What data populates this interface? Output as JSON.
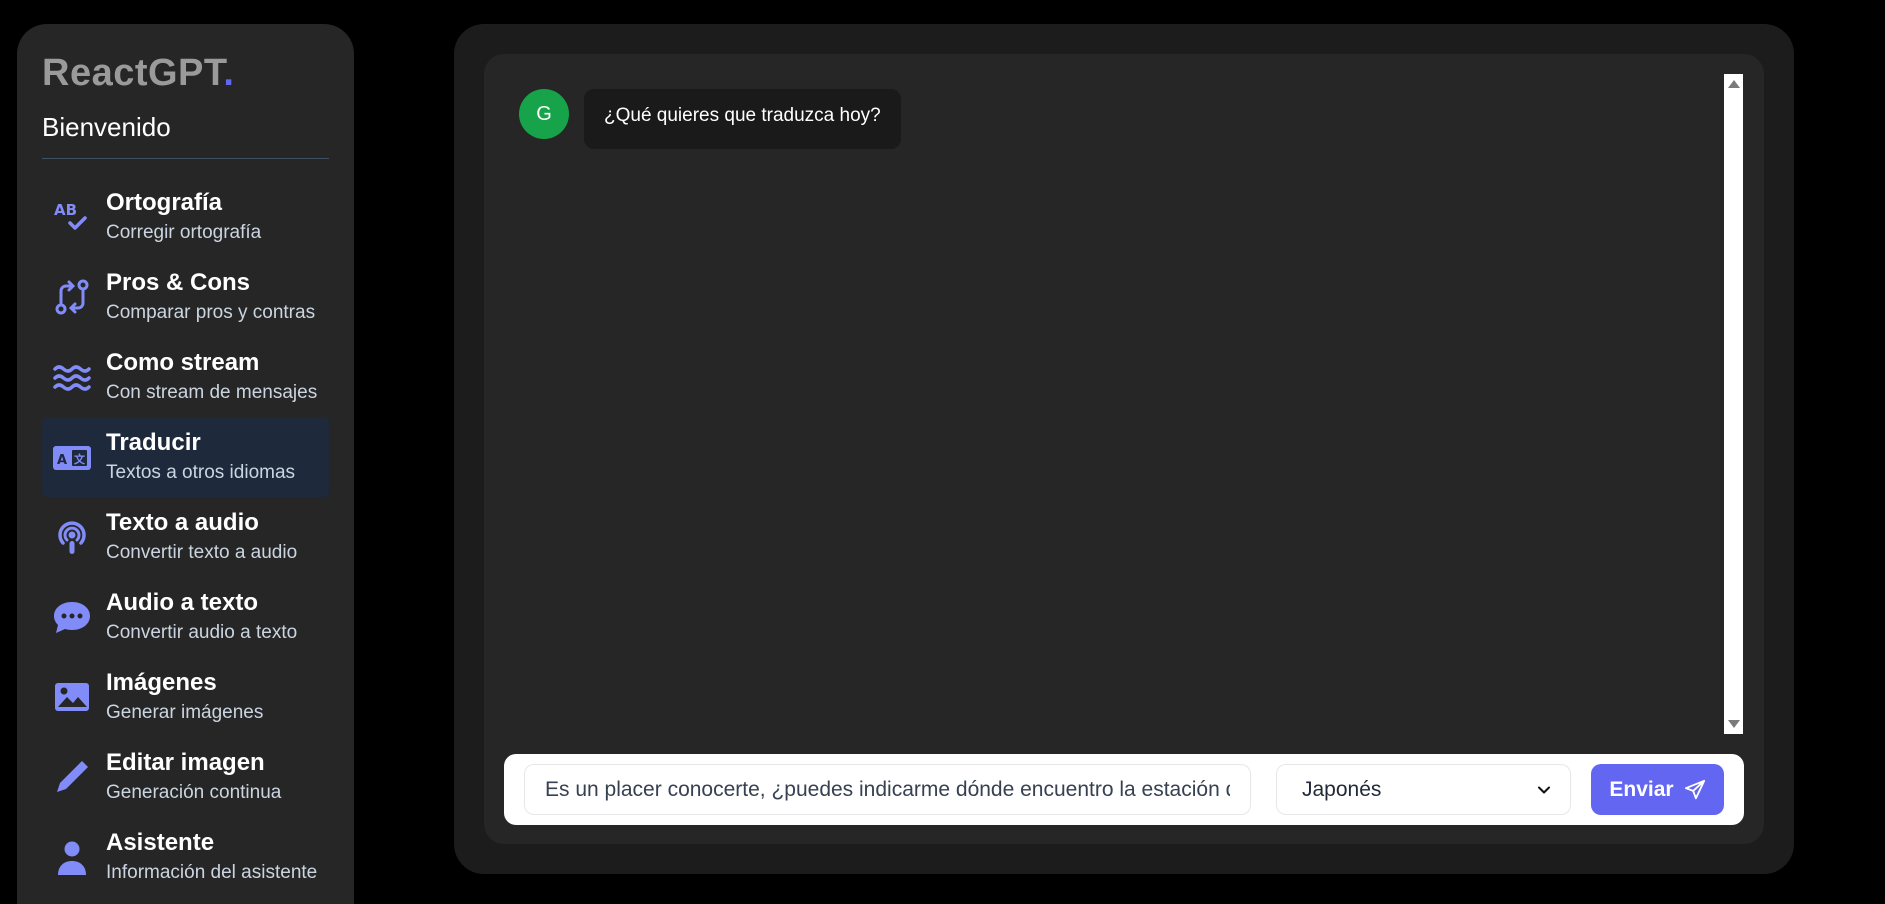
{
  "brand": {
    "name": "ReactGPT",
    "dot": "."
  },
  "welcome": "Bienvenido",
  "menu": [
    {
      "title": "Ortografía",
      "subtitle": "Corregir ortografía",
      "icon": "spell-check-icon"
    },
    {
      "title": "Pros & Cons",
      "subtitle": "Comparar pros y contras",
      "icon": "code-compare-icon"
    },
    {
      "title": "Como stream",
      "subtitle": "Con stream de mensajes",
      "icon": "water-icon"
    },
    {
      "title": "Traducir",
      "subtitle": "Textos a otros idiomas",
      "icon": "language-icon",
      "active": true
    },
    {
      "title": "Texto a audio",
      "subtitle": "Convertir texto a audio",
      "icon": "podcast-icon"
    },
    {
      "title": "Audio a texto",
      "subtitle": "Convertir audio a texto",
      "icon": "comment-dots-icon"
    },
    {
      "title": "Imágenes",
      "subtitle": "Generar imágenes",
      "icon": "image-icon"
    },
    {
      "title": "Editar imagen",
      "subtitle": "Generación continua",
      "icon": "pen-icon"
    },
    {
      "title": "Asistente",
      "subtitle": "Información del asistente",
      "icon": "user-icon"
    }
  ],
  "chat": {
    "messages": [
      {
        "avatar": "G",
        "text": "¿Qué quieres que traduzca hoy?"
      }
    ]
  },
  "input": {
    "value": "Es un placer conocerte, ¿puedes indicarme dónde encuentro la estación de tren?",
    "placeholder": ""
  },
  "language_select": {
    "selected": "Japonés"
  },
  "send_button": {
    "label": "Enviar"
  },
  "colors": {
    "accent": "#6366f1",
    "avatar": "#16a34a",
    "active_item": "#1e293b"
  }
}
